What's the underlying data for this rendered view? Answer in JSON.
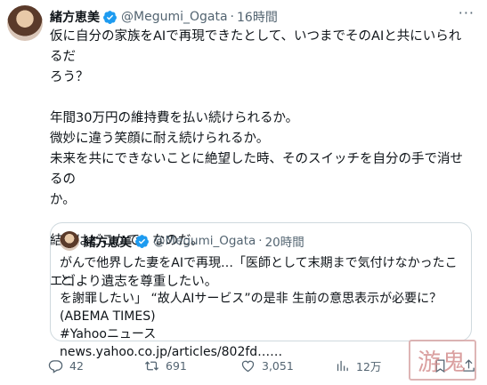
{
  "tweet": {
    "author_name": "緒方恵美",
    "handle": "@Megumi_Ogata",
    "separator": "·",
    "time": "16時間",
    "more_label": "···",
    "body": [
      "仮に自分の家族をAIで再現できたとして、いつまでそのAIと共にいられるだ\nろう？",
      "年間30万円の維持費を払い続けられるか。\n微妙に違う笑顔に耐え続けられるか。\n未来を共にできないことに絶望した時、そのスイッチを自分の手で消せるの\nか。",
      "結局はどこかで、なのだ。",
      "エゴより遺志を尊重したい。"
    ]
  },
  "quote": {
    "author_name": "緒方恵美",
    "handle": "@Megumi_Ogata",
    "separator": "·",
    "time": "20時間",
    "body": "がんで他界した妻をAIで再現…「医師として末期まで気付けなかったこと\nを謝罪したい」 “故人AIサービス”の是非 生前の意思表示が必要に？\n(ABEMA TIMES)\n#Yahooニュース\nnews.yahoo.co.jp/articles/802fd……"
  },
  "actions": {
    "replies": "42",
    "retweets": "691",
    "likes": "3,051",
    "views": "12万"
  },
  "watermark": {
    "text": "游鬼"
  },
  "colors": {
    "text": "#0f1419",
    "muted": "#536471",
    "verified": "#1d9bf0",
    "border": "#cfd9de"
  },
  "icons": [
    "verified-badge-icon",
    "more-icon",
    "reply-icon",
    "retweet-icon",
    "like-icon",
    "views-icon",
    "bookmark-icon",
    "share-icon"
  ]
}
